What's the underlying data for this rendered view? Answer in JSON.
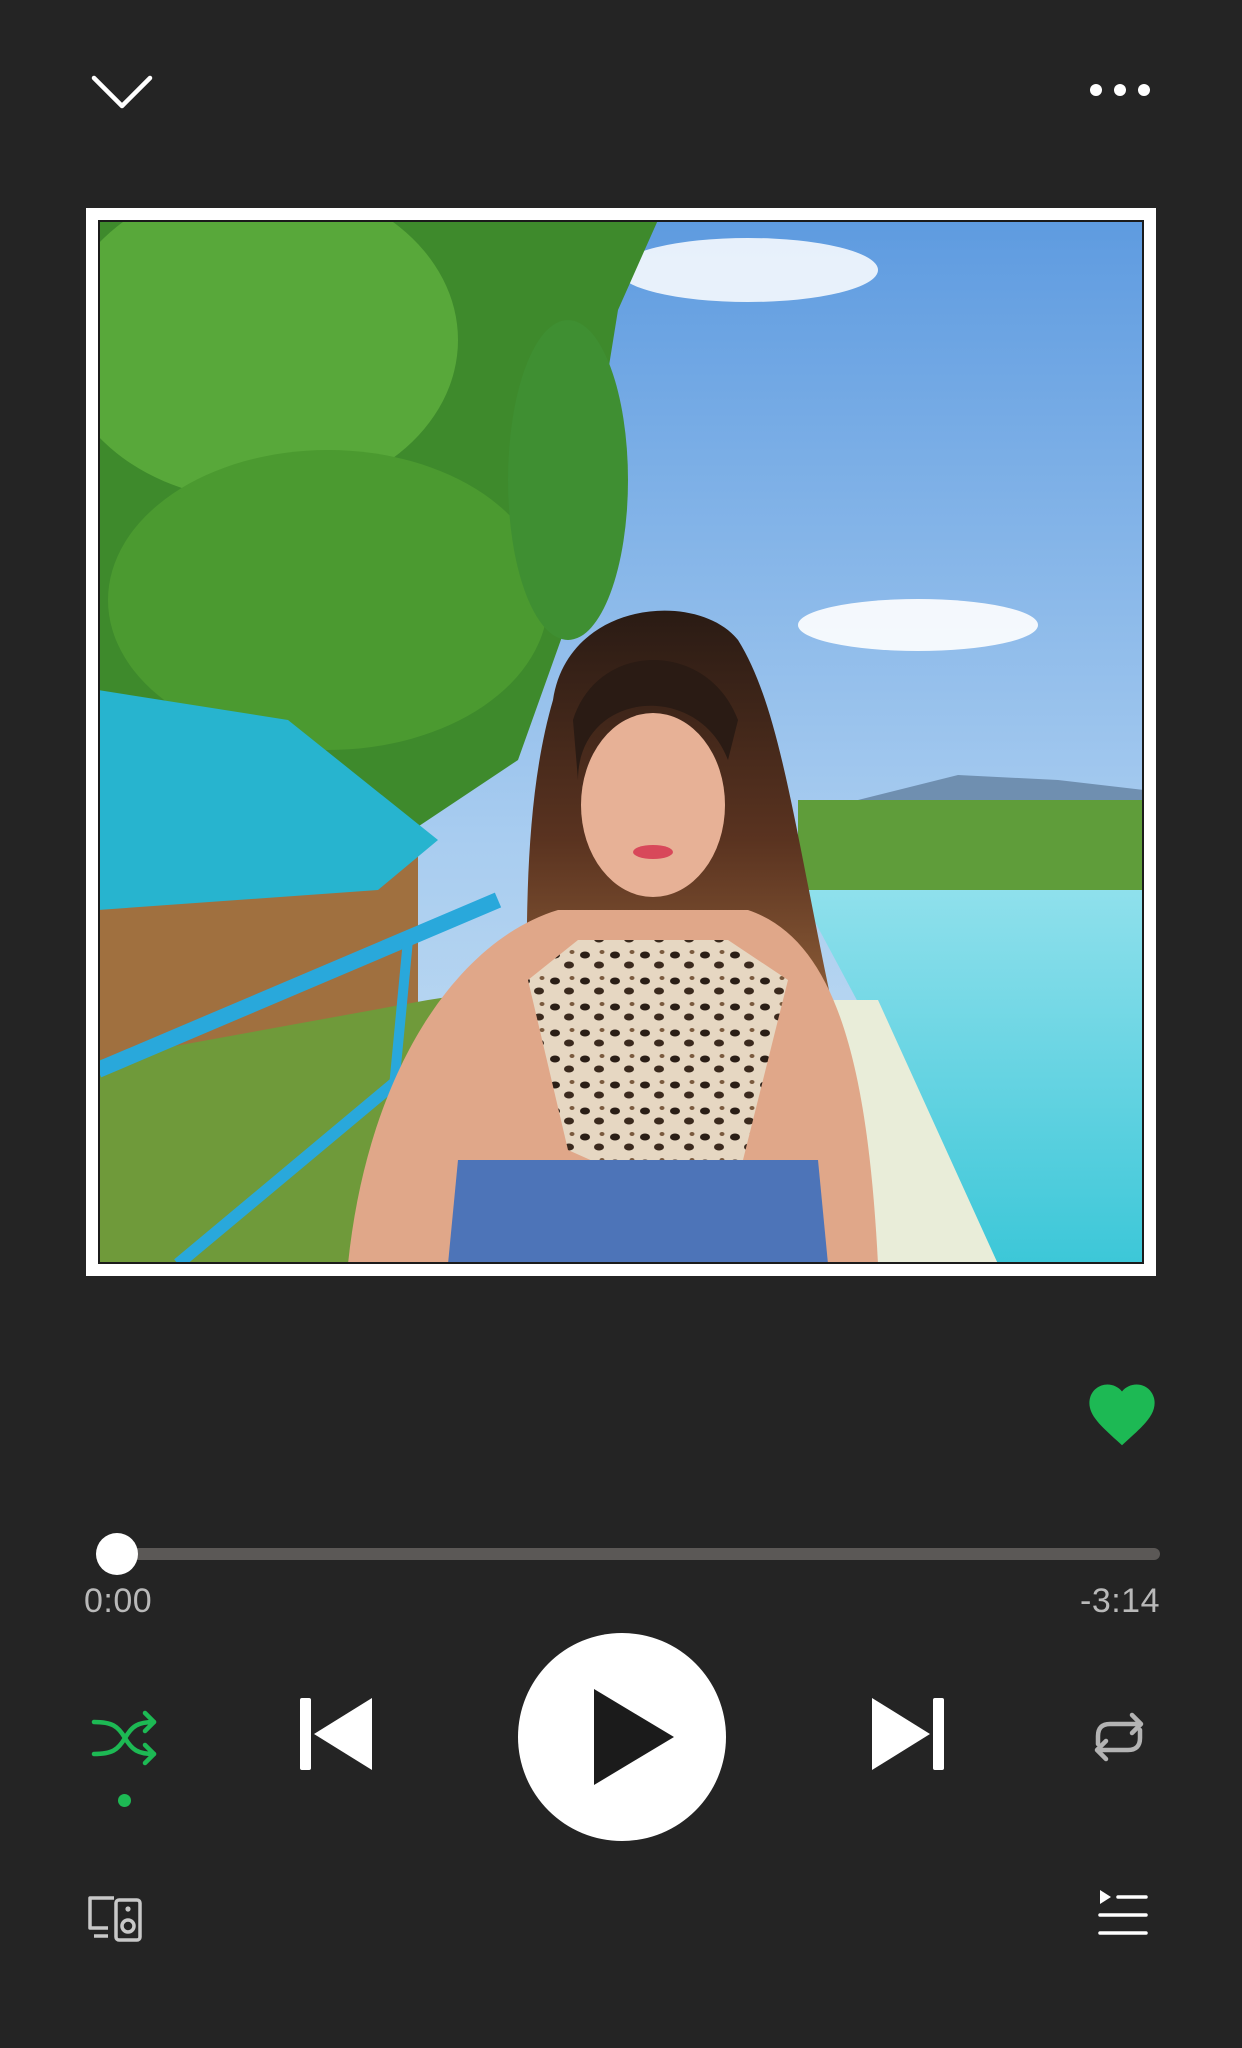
{
  "player": {
    "liked": true,
    "progress_fraction": 0.0,
    "elapsed": "0:00",
    "remaining": "-3:14",
    "shuffle_on": true,
    "repeat_on": false
  },
  "icons": {
    "collapse": "chevron-down-icon",
    "more": "more-options-icon",
    "like": "heart-icon",
    "shuffle": "shuffle-icon",
    "previous": "skip-previous-icon",
    "play": "play-icon",
    "next": "skip-next-icon",
    "repeat": "repeat-icon",
    "devices": "connect-devices-icon",
    "queue": "queue-icon"
  },
  "colors": {
    "background": "#242424",
    "accent": "#1db954",
    "track": "#5b5856",
    "text_secondary": "#b9b9b9",
    "icon": "#ffffff"
  }
}
